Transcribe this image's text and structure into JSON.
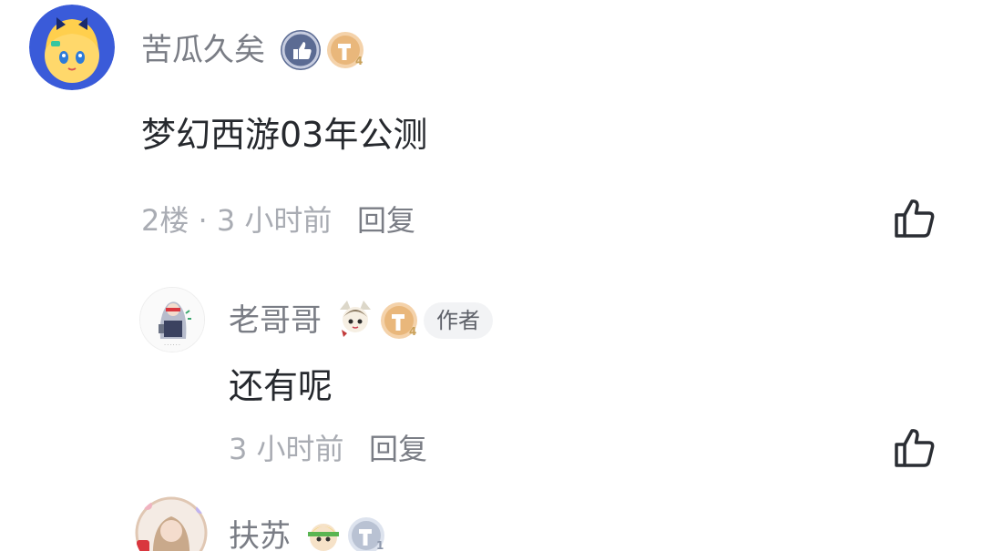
{
  "comments": [
    {
      "username": "苦瓜久矣",
      "content": "梦幻西游03年公测",
      "floor": "2楼",
      "separator": "·",
      "time": "3 小时前",
      "reply_label": "回复",
      "badge_level": "4",
      "replies": [
        {
          "username": "老哥哥",
          "author_tag": "作者",
          "content": "还有呢",
          "time": "3 小时前",
          "reply_label": "回复",
          "badge_level": "4"
        }
      ]
    },
    {
      "username": "扶苏",
      "badge_level": "1"
    }
  ],
  "colors": {
    "username": "#7a7d85",
    "content": "#26292e",
    "meta": "#a9acb3",
    "badge_gold": "#e9b77b",
    "badge_silver": "#b9c2d3",
    "verified_blue": "#5b6b93"
  }
}
